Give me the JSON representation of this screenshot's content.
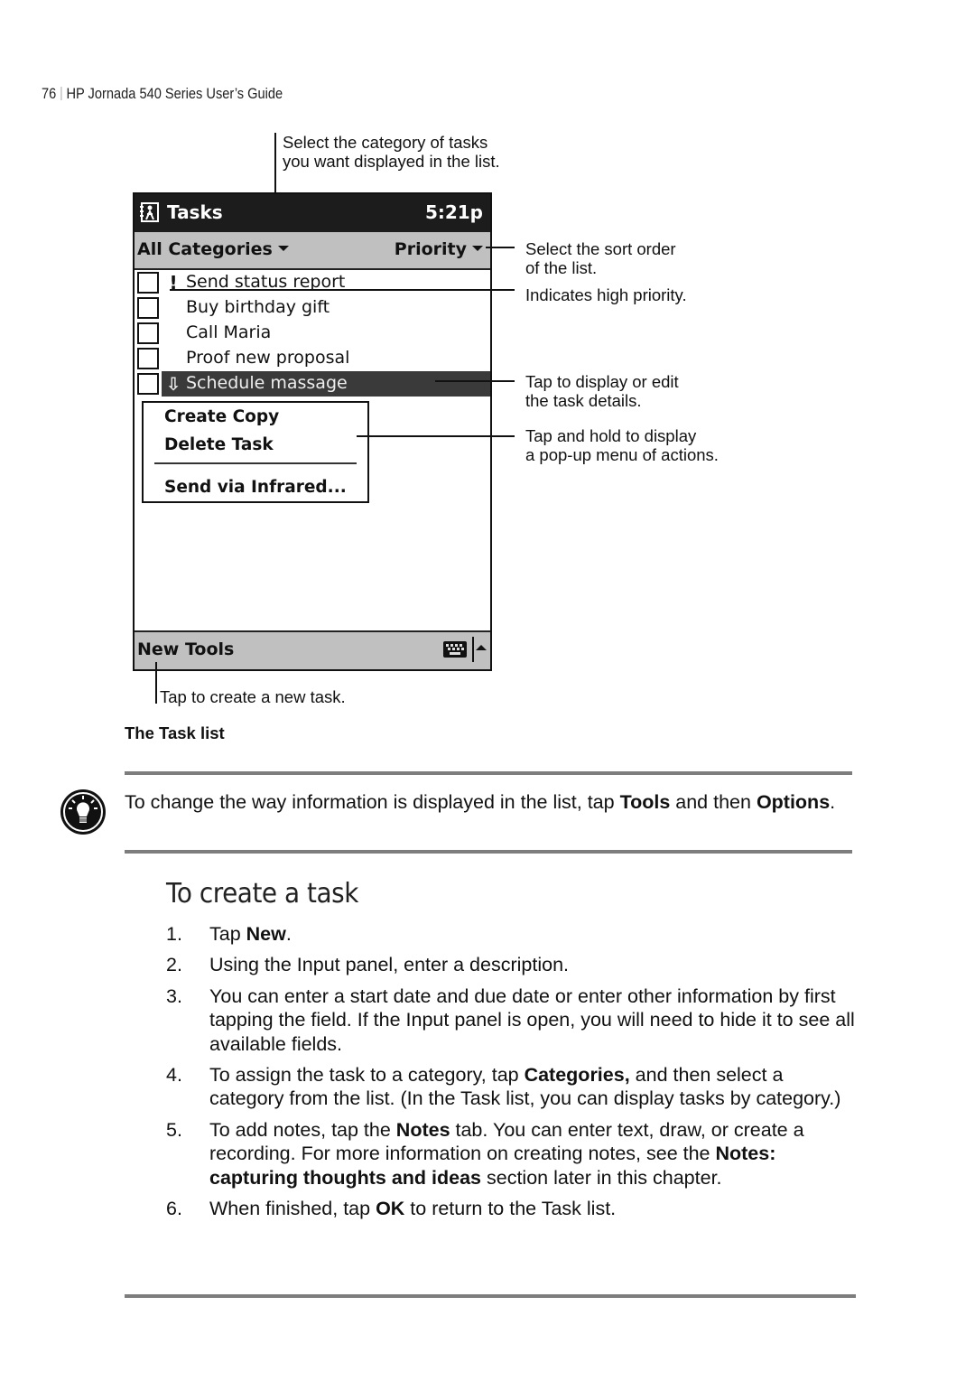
{
  "header": {
    "page_number": "76",
    "book_title": "HP Jornada 540 Series User’s Guide"
  },
  "figure": {
    "device": {
      "title_bar": {
        "app_icon": "tasks-app-icon",
        "title": "Tasks",
        "clock": "5:21p"
      },
      "filter_bar": {
        "category": "All Categories",
        "sort": "Priority"
      },
      "tasks": [
        {
          "label": "Send status report",
          "priority": "high",
          "priority_glyph": "!",
          "selected": false
        },
        {
          "label": "Buy birthday gift",
          "priority": "normal",
          "priority_glyph": "",
          "selected": false
        },
        {
          "label": "Call Maria",
          "priority": "normal",
          "priority_glyph": "",
          "selected": false
        },
        {
          "label": "Proof new proposal",
          "priority": "normal",
          "priority_glyph": "",
          "selected": false
        },
        {
          "label": "Schedule massage",
          "priority": "low",
          "priority_glyph": "⇩",
          "selected": true
        }
      ],
      "popup_menu": [
        "Create Copy",
        "Delete Task",
        "Send via Infrared..."
      ],
      "command_bar": {
        "new": "New",
        "tools": "Tools",
        "input_icon": "keyboard-icon",
        "input_toggle_icon": "up-arrow-icon"
      }
    },
    "callouts": {
      "category": [
        "Select the category of tasks",
        "you want displayed in the list."
      ],
      "sort": [
        "Select the sort order",
        "of the list."
      ],
      "priority": [
        "Indicates high priority."
      ],
      "details": [
        "Tap to display or edit",
        "the task details."
      ],
      "popup": [
        "Tap and hold to display",
        "a pop-up menu of actions."
      ],
      "new": [
        "Tap to create a new  task."
      ]
    },
    "caption": "The Task list"
  },
  "tip": {
    "icon": "lightbulb-icon",
    "text_before": "To change the way information is displayed in the list, tap ",
    "bold1": "Tools",
    "text_middle": " and then ",
    "bold2": "Options",
    "text_after": "."
  },
  "section": {
    "title": "To create a task",
    "steps": [
      {
        "num": "1.",
        "parts": [
          {
            "t": "Tap "
          },
          {
            "t": "New",
            "b": true
          },
          {
            "t": "."
          }
        ]
      },
      {
        "num": "2.",
        "parts": [
          {
            "t": "Using the Input panel, enter a description."
          }
        ]
      },
      {
        "num": "3.",
        "parts": [
          {
            "t": "You can enter a start date and due date or enter other information by first tapping the field. If the Input panel is open, you will need to hide it to see all available fields."
          }
        ]
      },
      {
        "num": "4.",
        "parts": [
          {
            "t": "To assign the task to a category, tap "
          },
          {
            "t": "Categories,",
            "b": true
          },
          {
            "t": " and then select a category from the list. (In the Task list, you can display tasks by category.)"
          }
        ]
      },
      {
        "num": "5.",
        "parts": [
          {
            "t": "To add notes, tap the "
          },
          {
            "t": "Notes",
            "b": true
          },
          {
            "t": " tab. You can enter text, draw, or create a recording. For more information on creating notes, see the "
          },
          {
            "t": "Notes: capturing thoughts and ideas",
            "b": true
          },
          {
            "t": " section later in this chapter."
          }
        ]
      },
      {
        "num": "6.",
        "parts": [
          {
            "t": "When finished, tap "
          },
          {
            "t": "OK",
            "b": true
          },
          {
            "t": " to return to the Task list."
          }
        ]
      }
    ]
  }
}
